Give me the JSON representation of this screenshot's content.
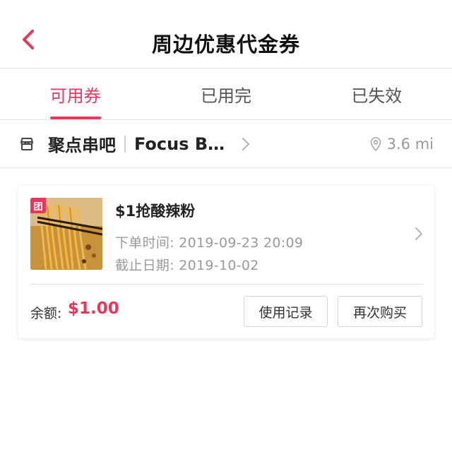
{
  "header": {
    "title": "周边优惠代金券",
    "back_icon": "chevron-left-icon",
    "accent_color": "#e8365d"
  },
  "tabs": [
    {
      "label": "可用券",
      "active": true
    },
    {
      "label": "已用完",
      "active": false
    },
    {
      "label": "已失效",
      "active": false
    }
  ],
  "store": {
    "icon": "store-icon",
    "name_cn": "聚点串吧",
    "name_en": "Focus B...",
    "distance": "3.6 mi"
  },
  "coupon": {
    "badge": "团",
    "title": "$1抢酸辣粉",
    "order_time": "下单时间: 2019-09-23 20:09",
    "expiry": "截止日期: 2019-10-02",
    "balance_label": "余额:",
    "balance_value": "$1.00",
    "records_button": "使用记录",
    "rebuy_button": "再次购买"
  }
}
